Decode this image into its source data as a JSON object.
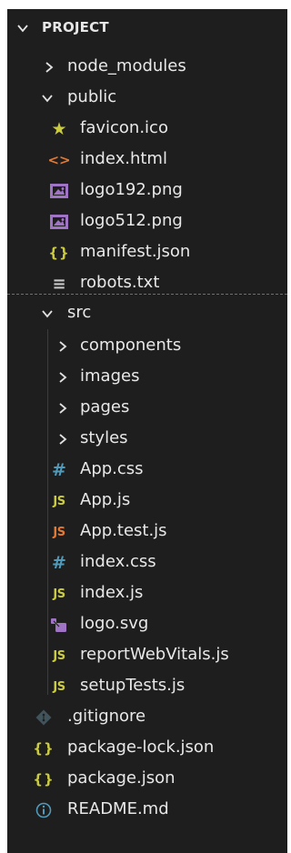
{
  "explorer": {
    "title": "PROJECT",
    "items": [
      {
        "label": "node_modules",
        "kind": "folder",
        "expanded": false
      },
      {
        "label": "public",
        "kind": "folder",
        "expanded": true
      },
      {
        "label": "favicon.ico",
        "kind": "file",
        "icon": "star-icon"
      },
      {
        "label": "index.html",
        "kind": "file",
        "icon": "html-icon"
      },
      {
        "label": "logo192.png",
        "kind": "file",
        "icon": "image-icon"
      },
      {
        "label": "logo512.png",
        "kind": "file",
        "icon": "image-icon"
      },
      {
        "label": "manifest.json",
        "kind": "file",
        "icon": "json-icon"
      },
      {
        "label": "robots.txt",
        "kind": "file",
        "icon": "text-file-icon"
      },
      {
        "label": "src",
        "kind": "folder",
        "expanded": true
      },
      {
        "label": "components",
        "kind": "folder",
        "expanded": false
      },
      {
        "label": "images",
        "kind": "folder",
        "expanded": false
      },
      {
        "label": "pages",
        "kind": "folder",
        "expanded": false
      },
      {
        "label": "styles",
        "kind": "folder",
        "expanded": false
      },
      {
        "label": "App.css",
        "kind": "file",
        "icon": "css-icon"
      },
      {
        "label": "App.js",
        "kind": "file",
        "icon": "js-icon"
      },
      {
        "label": "App.test.js",
        "kind": "file",
        "icon": "js-test-icon"
      },
      {
        "label": "index.css",
        "kind": "file",
        "icon": "css-icon"
      },
      {
        "label": "index.js",
        "kind": "file",
        "icon": "js-icon"
      },
      {
        "label": "logo.svg",
        "kind": "file",
        "icon": "svg-icon"
      },
      {
        "label": "reportWebVitals.js",
        "kind": "file",
        "icon": "js-icon"
      },
      {
        "label": "setupTests.js",
        "kind": "file",
        "icon": "js-icon"
      },
      {
        "label": ".gitignore",
        "kind": "file",
        "icon": "git-icon"
      },
      {
        "label": "package-lock.json",
        "kind": "file",
        "icon": "json-icon"
      },
      {
        "label": "package.json",
        "kind": "file",
        "icon": "json-icon"
      },
      {
        "label": "README.md",
        "kind": "file",
        "icon": "info-icon"
      }
    ]
  },
  "icon_text": {
    "js": "JS",
    "css": "#",
    "json": "{}",
    "html": "<>",
    "txt": "≡",
    "star": "★"
  },
  "colors": {
    "background": "#1e1e1e",
    "text": "#e8e8e8",
    "js": "#cbcb41",
    "js_test": "#e37933",
    "css": "#519aba",
    "html": "#e37933",
    "image": "#a074c4",
    "svg": "#a074c4",
    "info": "#519aba",
    "separator": "#a65e2e"
  }
}
